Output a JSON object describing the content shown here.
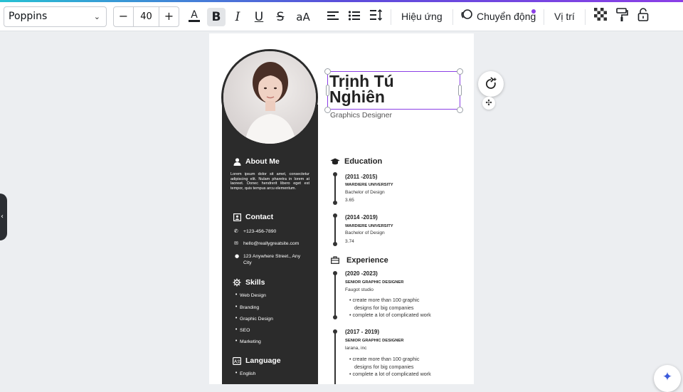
{
  "toolbar": {
    "font_name": "Poppins",
    "font_size": "40",
    "minus": "−",
    "plus": "+",
    "effects_label": "Hiệu ứng",
    "animate_label": "Chuyển động",
    "position_label": "Vị trí"
  },
  "resume": {
    "name_line1": "Trịnh Tú",
    "name_line2": "Nghiên",
    "title": "Graphics Designer",
    "about": {
      "heading": "About Me",
      "text": "Lorem ipsum dolor sit amet, consectetur adipiscing elit. Nulam pharetra in lorem at laoreet. Donec hendrerit libero eget est tempor, quis tempus arcu elementum."
    },
    "contact": {
      "heading": "Contact",
      "phone": "+123-456-7890",
      "email": "hello@reallygreatsite.com",
      "address_line1": "123 Anywhere Street., Any",
      "address_line2": "City"
    },
    "skills": {
      "heading": "Skills",
      "items": [
        "Web Design",
        "Branding",
        "Graphic Design",
        "SEO",
        "Marketing"
      ]
    },
    "language": {
      "heading": "Language",
      "items": [
        "English"
      ]
    },
    "education": {
      "heading": "Education",
      "entries": [
        {
          "date": "(2011 -2015)",
          "org": "WARDIERE UNIVERSITY",
          "degree": "Bachelor of Design",
          "gpa": "3.65"
        },
        {
          "date": "(2014 -2019)",
          "org": "WARDIERE UNIVERSITY",
          "degree": "Bachelor of Design",
          "gpa": "3.74"
        }
      ]
    },
    "experience": {
      "heading": "Experience",
      "entries": [
        {
          "date": "(2020 -2023)",
          "role": "SENIOR GRAPHIC DESIGNER",
          "company": "Faugot studio",
          "b1a": "create more than 100 graphic",
          "b1b": "designs for big companies",
          "b2": "complete a lot of complicated work"
        },
        {
          "date": "(2017 - 2019)",
          "role": "SENIOR GRAPHIC DESIGNER",
          "company": "larana, inc",
          "b1a": "create more than 100 graphic",
          "b1b": "designs for big companies",
          "b2": "complete a lot of complicated work"
        }
      ]
    }
  }
}
